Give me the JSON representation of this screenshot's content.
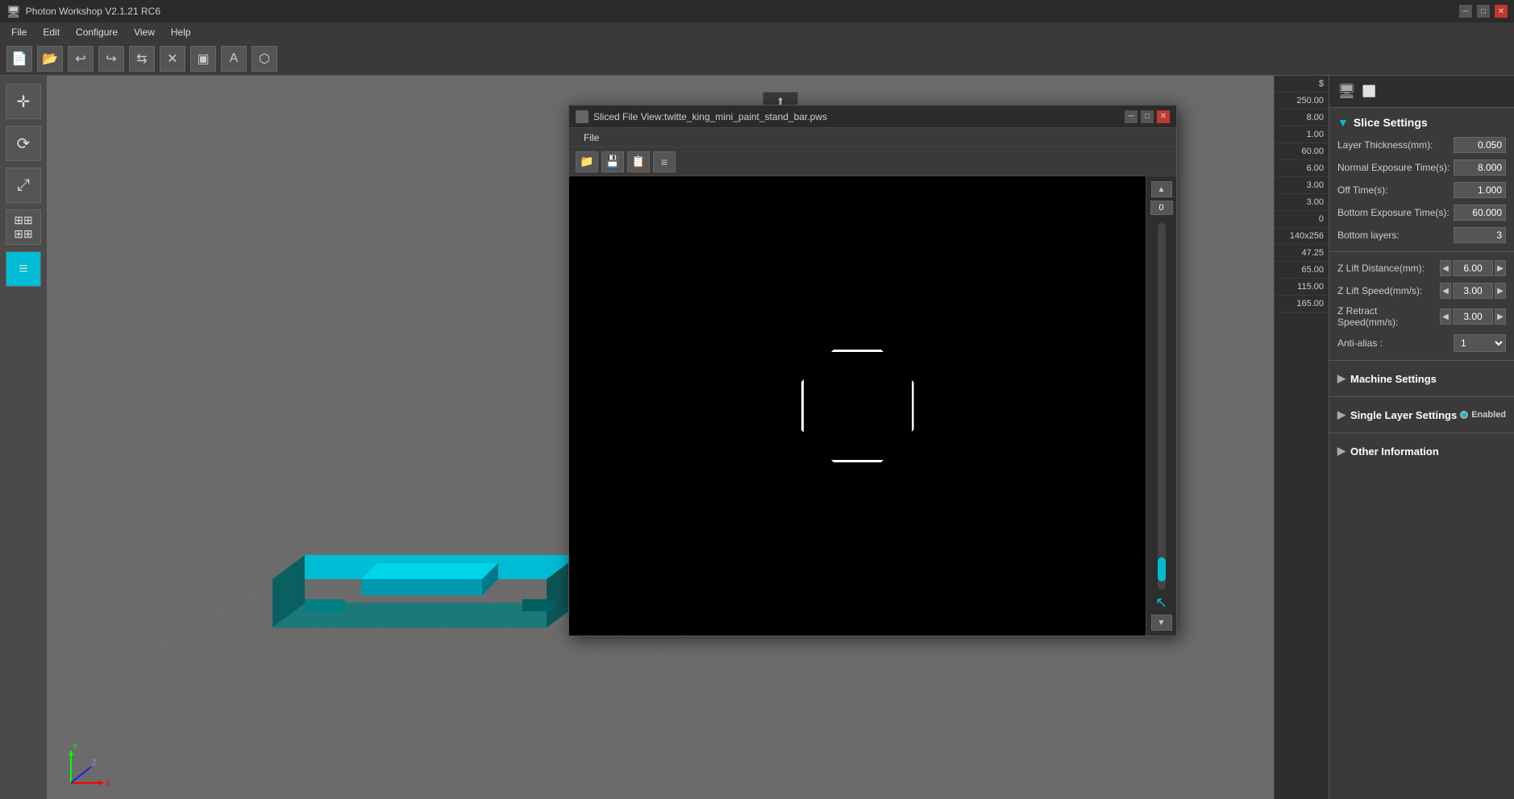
{
  "app": {
    "title": "Photon Workshop V2.1.21 RC6",
    "file_menu": "File",
    "edit_menu": "Edit",
    "configure_menu": "Configure",
    "view_menu": "View",
    "help_menu": "Help"
  },
  "toolbar": {
    "buttons": [
      "new",
      "open",
      "undo",
      "redo",
      "mirror",
      "delete",
      "rect-select",
      "text",
      "shape"
    ]
  },
  "sliced_dialog": {
    "title": "Sliced File View:twitte_king_mini_paint_stand_bar.pws",
    "file_menu": "File",
    "layer_value": "0"
  },
  "slice_settings": {
    "title": "Slice Settings",
    "layer_thickness_label": "Layer Thickness(mm):",
    "layer_thickness_value": "0.050",
    "normal_exposure_label": "Normal Exposure Time(s):",
    "normal_exposure_value": "8.000",
    "off_time_label": "Off Time(s):",
    "off_time_value": "1.000",
    "bottom_exposure_label": "Bottom Exposure Time(s):",
    "bottom_exposure_value": "60.000",
    "bottom_layers_label": "Bottom layers:",
    "bottom_layers_value": "3",
    "z_lift_dist_label": "Z Lift Distance(mm):",
    "z_lift_dist_value": "6.00",
    "z_lift_speed_label": "Z Lift Speed(mm/s):",
    "z_lift_speed_value": "3.00",
    "z_retract_speed_label": "Z Retract Speed(mm/s):",
    "z_retract_speed_value": "3.00",
    "anti_alias_label": "Anti-alias :",
    "anti_alias_value": "1",
    "machine_settings_label": "Machine Settings",
    "single_layer_label": "Single Layer Settings",
    "single_layer_enabled": "Enabled",
    "other_info_label": "Other Information"
  },
  "right_values": {
    "items": [
      "$",
      "250.00",
      "8.00",
      "1.00",
      "60.00",
      "6.00",
      "3.00",
      "3.00",
      "0",
      "140x256",
      "47.25",
      "65.00",
      "115.00",
      "165.00"
    ]
  },
  "sidebar_tools": [
    {
      "name": "move",
      "icon": "✛"
    },
    {
      "name": "rotate",
      "icon": "⟳"
    },
    {
      "name": "scale",
      "icon": "⤢"
    },
    {
      "name": "grid",
      "icon": "⊞"
    },
    {
      "name": "layers",
      "icon": "≡"
    }
  ]
}
